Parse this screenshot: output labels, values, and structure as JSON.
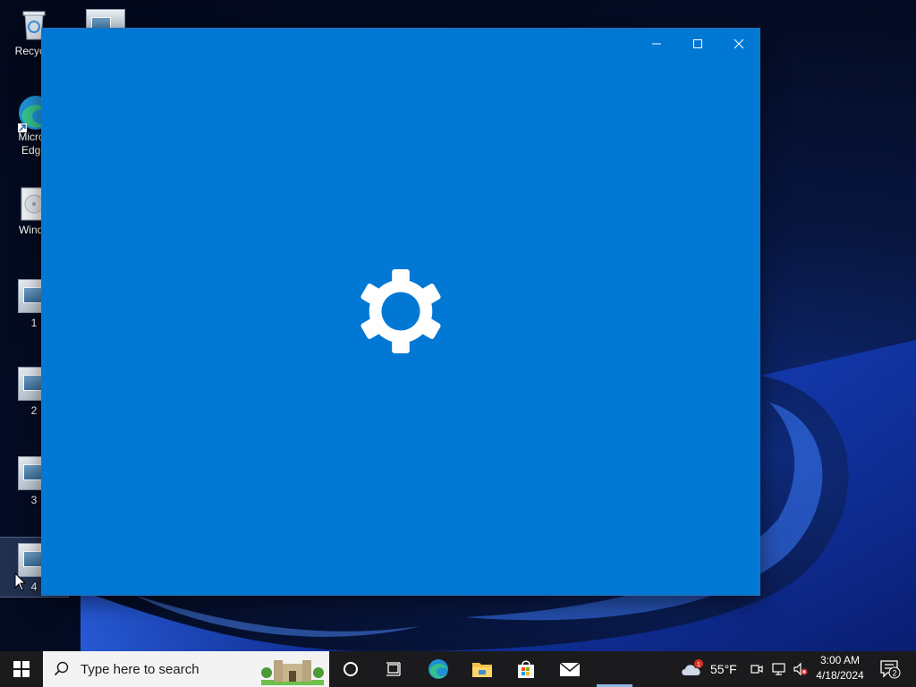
{
  "desktop": {
    "icons": [
      {
        "label": "Recycle"
      },
      {
        "label": "Micros\nEdge"
      },
      {
        "label": "Windo"
      },
      {
        "label": "1"
      },
      {
        "label": "2"
      },
      {
        "label": "3"
      },
      {
        "label": "4"
      }
    ]
  },
  "window": {
    "minimize_icon": "minimize-icon",
    "maximize_icon": "maximize-icon",
    "close_icon": "close-icon",
    "splash_icon": "gear-icon",
    "background": "#0078d4"
  },
  "taskbar": {
    "search_placeholder": "Type here to search",
    "weather_temp": "55°F",
    "weather_badge": "1",
    "time": "3:00 AM",
    "date": "4/18/2024",
    "notification_count": "2"
  }
}
